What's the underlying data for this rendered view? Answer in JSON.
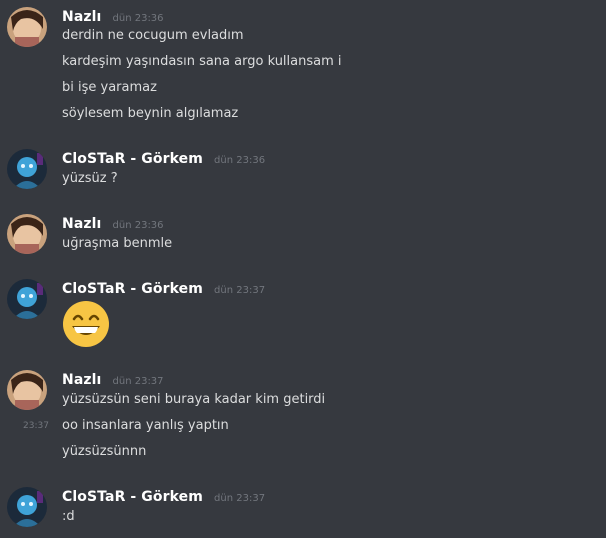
{
  "users": {
    "nazli": {
      "name": "Nazlı"
    },
    "clostar": {
      "name": "CloSTaR - Görkem"
    }
  },
  "messages": [
    {
      "author": "Nazlı",
      "time": "dün 23:36",
      "lines": [
        "derdin ne cocugum evladım",
        "kardeşim yaşındasın sana argo kullansam i",
        "bi işe yaramaz",
        "söylesem beynin algılamaz"
      ]
    },
    {
      "author": "CloSTaR - Görkem",
      "time": "dün 23:36",
      "lines": [
        "yüzsüz ?"
      ]
    },
    {
      "author": "Nazlı",
      "time": "dün 23:36",
      "lines": [
        "uğraşma benmle"
      ]
    },
    {
      "author": "CloSTaR - Görkem",
      "time": "dün 23:37",
      "emoji": "grinning-face-emoji"
    },
    {
      "author": "Nazlı",
      "time": "dün 23:37",
      "lines": [
        "yüzsüzsün seni buraya kadar kim getirdi",
        "oo insanlara yanlış yaptın",
        "yüzsüzsünnn"
      ],
      "hover_time": "23:37"
    },
    {
      "author": "CloSTaR - Görkem",
      "time": "dün 23:37",
      "lines": [
        ":d"
      ]
    }
  ],
  "colors": {
    "background": "#36393f",
    "username": "#ffffff",
    "text": "#dcddde",
    "timestamp": "#72767d",
    "emoji": "#f7c544"
  }
}
